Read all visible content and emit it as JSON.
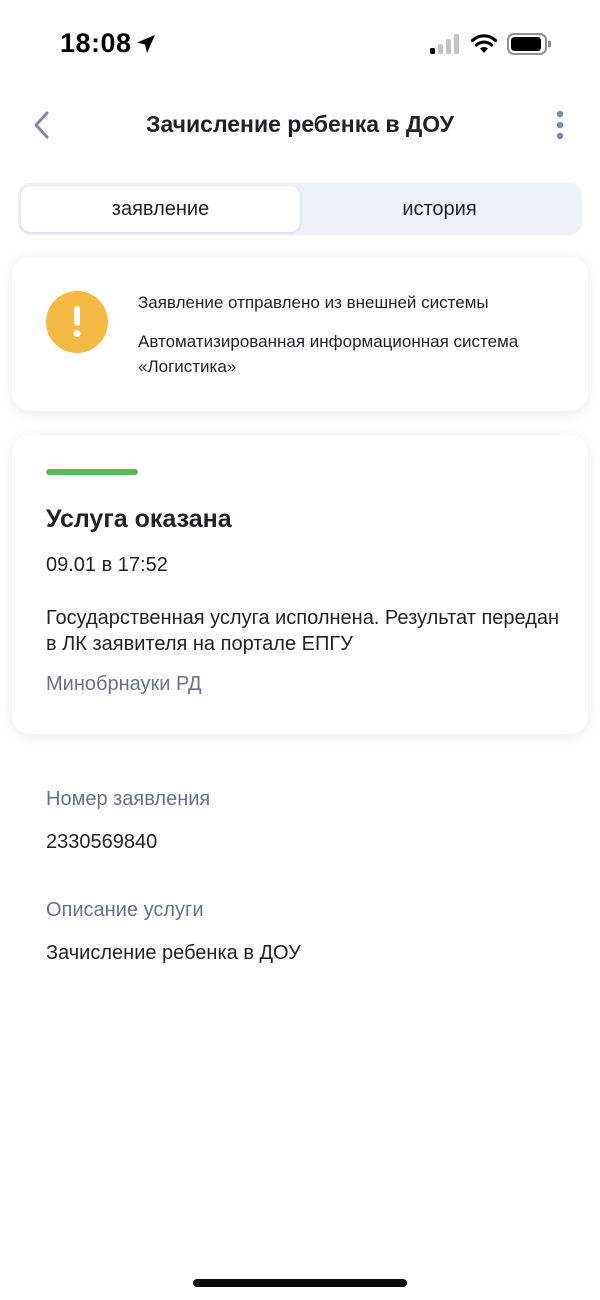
{
  "status_bar": {
    "time": "18:08",
    "icons": [
      "location-arrow-icon",
      "cellular-signal-icon",
      "wifi-icon",
      "battery-icon"
    ]
  },
  "header": {
    "title": "Зачисление ребенка в ДОУ",
    "back_icon": "chevron-left-icon",
    "menu_icon": "more-vertical-icon"
  },
  "tabs": [
    {
      "label": "заявление",
      "active": true
    },
    {
      "label": "история",
      "active": false
    }
  ],
  "notice": {
    "icon": "warning-icon",
    "title": "Заявление отправлено из внешней системы",
    "body": "Автоматизированная информационная система «Логистика»"
  },
  "status_card": {
    "title": "Услуга оказана",
    "date": "09.01 в 17:52",
    "description": "Государственная услуга исполнена. Результат передан в ЛК заявителя на портале ЕПГУ",
    "organization": "Минобрнауки РД"
  },
  "fields": [
    {
      "label": "Номер заявления",
      "value": "2330569840"
    },
    {
      "label": "Описание услуги",
      "value": "Зачисление ребенка в ДОУ"
    }
  ],
  "colors": {
    "accent_success": "#5cb85c",
    "warning": "#f4b845",
    "secondary_text": "#66728a",
    "segment_background": "#edf2f9",
    "icon_gray": "#7a8aa8"
  }
}
